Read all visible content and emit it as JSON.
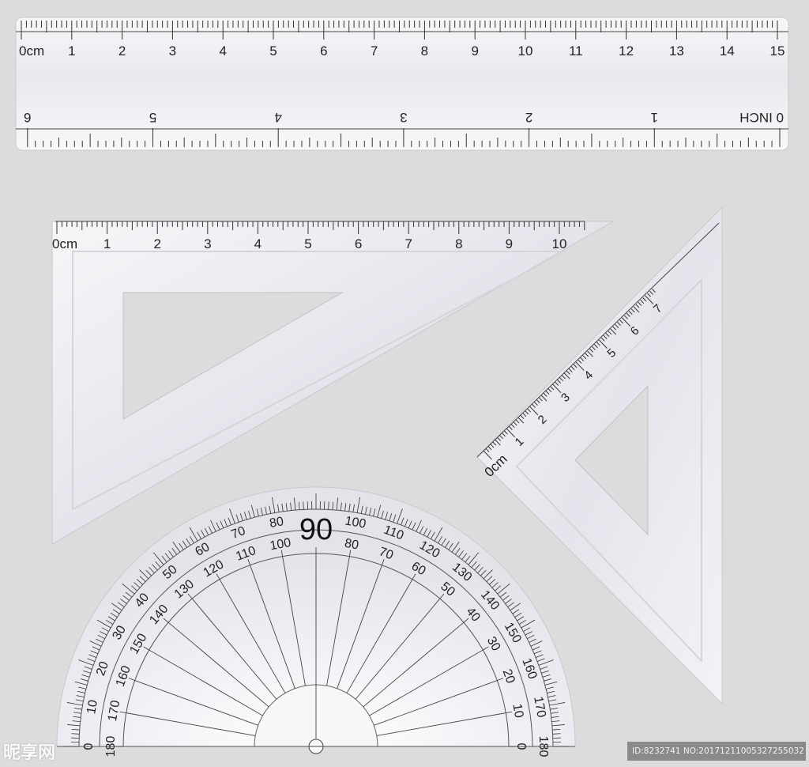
{
  "straight_ruler": {
    "cm_unit_label": "0cm",
    "cm_labels": [
      "1",
      "2",
      "3",
      "4",
      "5",
      "6",
      "7",
      "8",
      "9",
      "10",
      "11",
      "12",
      "13",
      "14",
      "15"
    ],
    "inch_unit_label": "0 INCH",
    "inch_labels": [
      "1",
      "2",
      "3",
      "4",
      "5",
      "6"
    ]
  },
  "set_square_45": {
    "unit_label": "0cm",
    "labels": [
      "1",
      "2",
      "3",
      "4",
      "5",
      "6",
      "7",
      "8",
      "9",
      "10"
    ]
  },
  "set_square_60": {
    "unit_label": "0cm",
    "labels": [
      "1",
      "2",
      "3",
      "4",
      "5",
      "6",
      "7"
    ]
  },
  "protractor": {
    "top_label": "90",
    "outer_labels": [
      "0",
      "10",
      "20",
      "30",
      "40",
      "50",
      "60",
      "70",
      "80",
      "100",
      "110",
      "120",
      "130",
      "140",
      "150",
      "160",
      "170",
      "180"
    ],
    "inner_labels": [
      "180",
      "170",
      "160",
      "150",
      "140",
      "130",
      "120",
      "110",
      "100",
      "80",
      "70",
      "60",
      "50",
      "40",
      "30",
      "20",
      "10",
      "0"
    ]
  },
  "watermark": {
    "site": "昵享网",
    "id_text": "ID:8232741 NO:20171211005327255032"
  },
  "colors": {
    "background": "#dcdcdc",
    "instrument_fill": "#f1f2f5",
    "tick": "#333333",
    "label": "#222222"
  }
}
